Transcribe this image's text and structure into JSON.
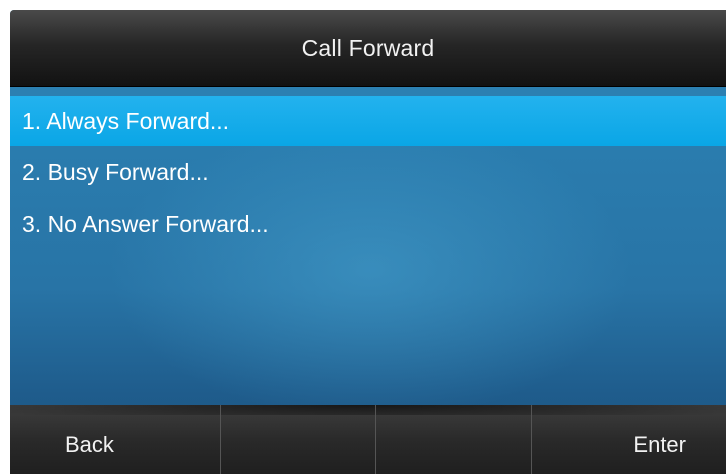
{
  "screen": {
    "title": "Call Forward"
  },
  "menu": {
    "items": [
      {
        "label": "1. Always Forward...",
        "selected": true
      },
      {
        "label": "2. Busy Forward...",
        "selected": false
      },
      {
        "label": "3. No Answer Forward...",
        "selected": false
      }
    ]
  },
  "softkeys": {
    "key1": "Back",
    "key2": "",
    "key3": "",
    "key4": "Enter"
  },
  "colors": {
    "title_bar": "#262626",
    "background": "#2a7cae",
    "selection": "#0aa6e6",
    "softkey_bar": "#2a2a2a",
    "text": "#ffffff"
  }
}
